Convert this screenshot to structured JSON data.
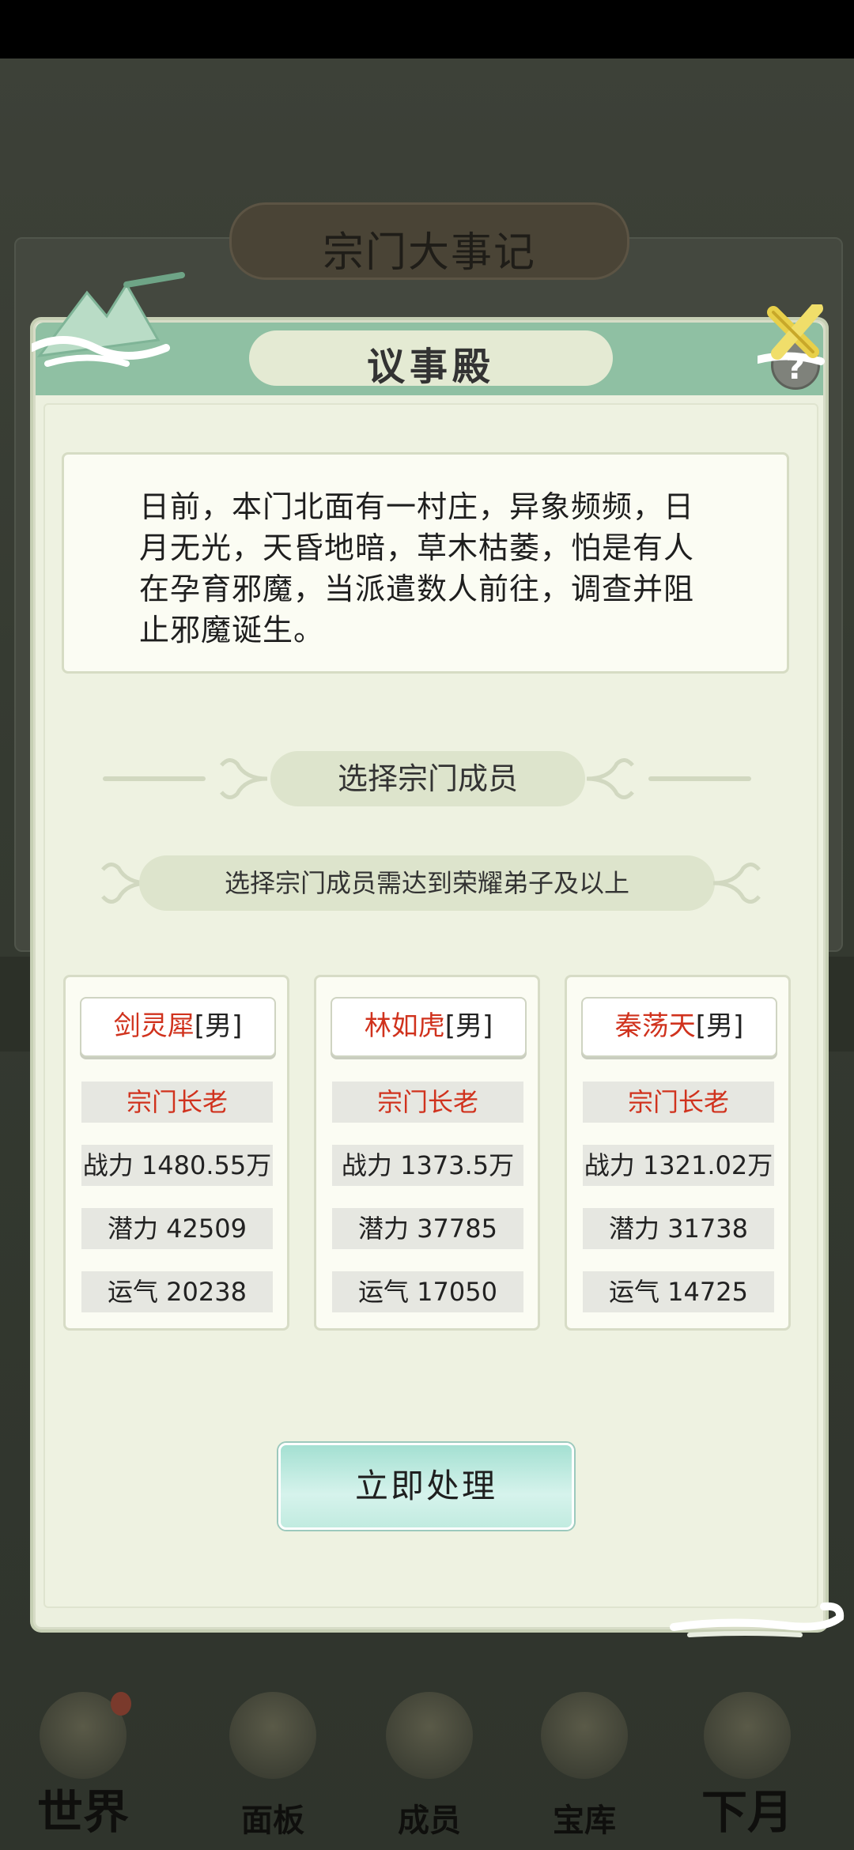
{
  "background": {
    "banner_title": "宗门大事记",
    "nav": [
      {
        "label": "世界",
        "icon": "world-icon"
      },
      {
        "label": "面板",
        "icon": "panel-icon"
      },
      {
        "label": "成员",
        "icon": "members-icon"
      },
      {
        "label": "宝库",
        "icon": "treasury-icon"
      },
      {
        "label": "下月",
        "icon": "next-month-icon"
      }
    ]
  },
  "modal": {
    "title": "议事殿",
    "help_glyph": "?",
    "description": "日前，本门北面有一村庄，异象频频，日月无光，天昏地暗，草木枯萎，怕是有人在孕育邪魔，当派遣数人前往，调查并阻止邪魔诞生。",
    "section_title": "选择宗门成员",
    "requirement": "选择宗门成员需达到荣耀弟子及以上",
    "members": [
      {
        "name": "剑灵犀",
        "gender": "[男]",
        "rank": "宗门长老",
        "power": "战力 1480.55万",
        "potential": "潜力 42509",
        "luck": "运气 20238"
      },
      {
        "name": "林如虎",
        "gender": "[男]",
        "rank": "宗门长老",
        "power": "战力 1373.5万",
        "potential": "潜力 37785",
        "luck": "运气 17050"
      },
      {
        "name": "秦荡天",
        "gender": "[男]",
        "rank": "宗门长老",
        "power": "战力 1321.02万",
        "potential": "潜力 31738",
        "luck": "运气 14725"
      }
    ],
    "action_button": "立即处理"
  },
  "colors": {
    "header_green": "#8fc0a3",
    "panel_bg": "#ecf0df",
    "accent_red": "#d0321d",
    "button_teal": "#a4e0d2"
  }
}
